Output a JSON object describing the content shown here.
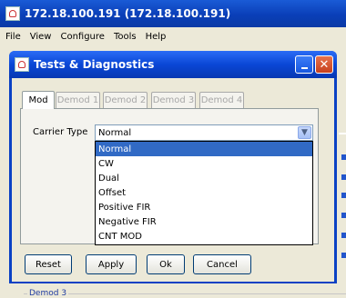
{
  "window": {
    "title": "172.18.100.191 (172.18.100.191)"
  },
  "menu": [
    "File",
    "View",
    "Configure",
    "Tools",
    "Help"
  ],
  "dialog": {
    "title": "Tests & Diagnostics",
    "tabs": [
      "Mod",
      "Demod 1",
      "Demod 2",
      "Demod 3",
      "Demod 4"
    ],
    "carrier_label": "Carrier Type",
    "carrier_value": "Normal",
    "options": [
      "Normal",
      "CW",
      "Dual",
      "Offset",
      "Positive FIR",
      "Negative FIR",
      "CNT MOD"
    ],
    "buttons": {
      "reset": "Reset",
      "apply": "Apply",
      "ok": "Ok",
      "cancel": "Cancel"
    }
  },
  "background": {
    "group_label": "Demod 3"
  }
}
